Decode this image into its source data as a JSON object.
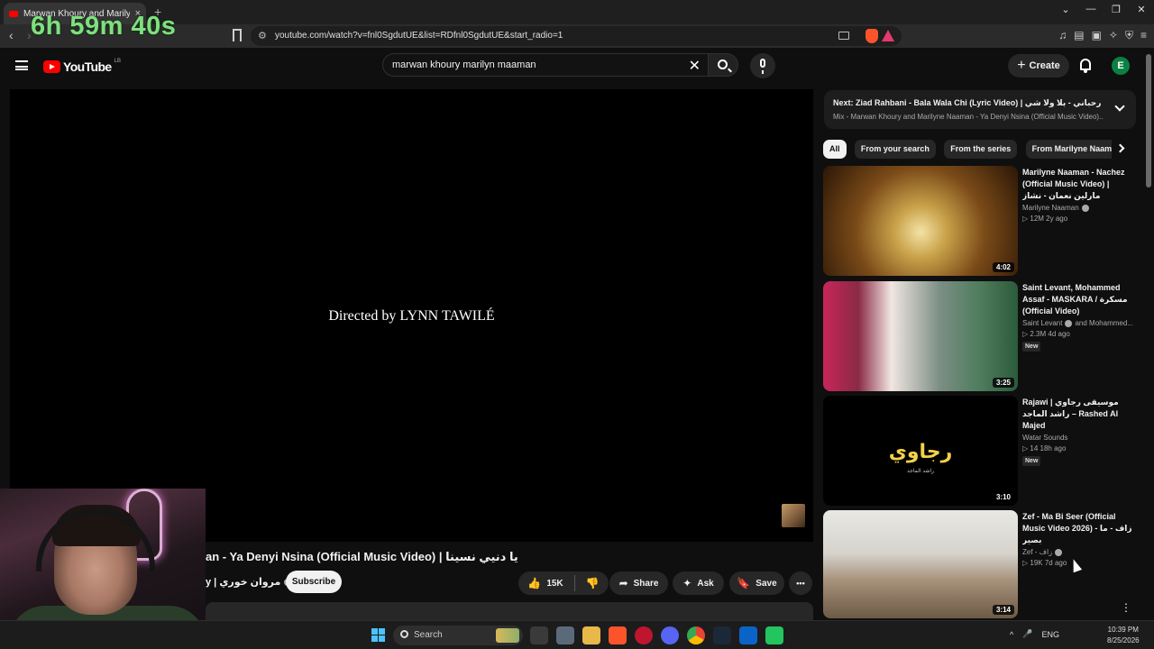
{
  "browser": {
    "tab_title": "Marwan Khoury and Marilyne Naaman",
    "tab_close": "×",
    "new_tab": "+",
    "url": "youtube.com/watch?v=fnl0SgdutUE&list=RDfnl0SgdutUE&start_radio=1",
    "window_controls": [
      "⌄",
      "—",
      "❐",
      "✕"
    ],
    "back": "‹",
    "forward": "›",
    "toolbar_icons": [
      "♫",
      "▤",
      "▣",
      "✧",
      "⛨",
      "≡"
    ]
  },
  "overlay": {
    "timer": "6h 59m 40s"
  },
  "youtube": {
    "logo_text": "YouTube",
    "logo_country": "LB",
    "search_query": "marwan khoury marilyn maaman",
    "search_clear": "✕",
    "create_label": "Create",
    "create_plus": "+",
    "avatar_letter": "E"
  },
  "player": {
    "credit_text": "Directed by LYNN TAWILÉ"
  },
  "video": {
    "title": "an - Ya Denyi Nsina (Official Music Video) | يا دنيي نسينا",
    "channel": "y | مروان خوري",
    "subscribe_label": "Subscribe",
    "likes": "15K",
    "like_icon": "👍",
    "dislike_icon": "👎",
    "share_label": "Share",
    "share_icon": "➦",
    "ask_label": "Ask",
    "ask_icon": "✦",
    "save_label": "Save",
    "save_icon": "🔖",
    "more_icon": "•••"
  },
  "up_next": {
    "title": "Next: Ziad Rahbani - Bala Wala Chi (Lyric Video) | زياد رحباني - بلا ولا شي",
    "subtitle": "Mix - Marwan Khoury and Marilyne Naaman - Ya Denyi Nsina (Official Music Video)..."
  },
  "chips": [
    "All",
    "From your search",
    "From the series",
    "From Marilyne Naaman"
  ],
  "recommendations": [
    {
      "title": "Marilyne Naaman - Nachez (Official Music Video) | مارلين نعمان - نشاز",
      "channel": "Marilyne Naaman",
      "co_channel": "",
      "views": "▷ 12M",
      "age": "2y ago",
      "badge": "",
      "duration": "4:02"
    },
    {
      "title": "Saint Levant, Mohammed Assaf - MASKARA / مسكرة (Official Video)",
      "channel": "Saint Levant",
      "co_channel": "and Mohammed...",
      "views": "▷ 2.3M",
      "age": "4d ago",
      "badge": "New",
      "duration": "3:25"
    },
    {
      "title": "Rajawi | موسيقى رجاوي راشد الماجد – Rashed Al Majed",
      "channel": "Watar Sounds",
      "co_channel": "",
      "views": "▷ 14",
      "age": "18h ago",
      "badge": "New",
      "duration": "3:10",
      "thumb_text": "رجاوي",
      "thumb_sub": "راشد الماجد"
    },
    {
      "title": "Zef - Ma Bi Seer (Official Music Video 2026) - زاف - ما بصير",
      "channel": "Zef - زاف",
      "co_channel": "",
      "views": "▷ 19K",
      "age": "7d ago",
      "badge": "",
      "duration": "3:14"
    }
  ],
  "taskbar": {
    "search_label": "Search",
    "language": "ENG",
    "time": "10:39 PM",
    "date": "8/25/2026",
    "tray_icons": [
      "^",
      "🎤"
    ]
  },
  "colors": {
    "background": "#0f0f0f",
    "accent_red": "#ff0000",
    "timer_green": "#7ee07e",
    "windows_blue": "#4cc2ff"
  }
}
